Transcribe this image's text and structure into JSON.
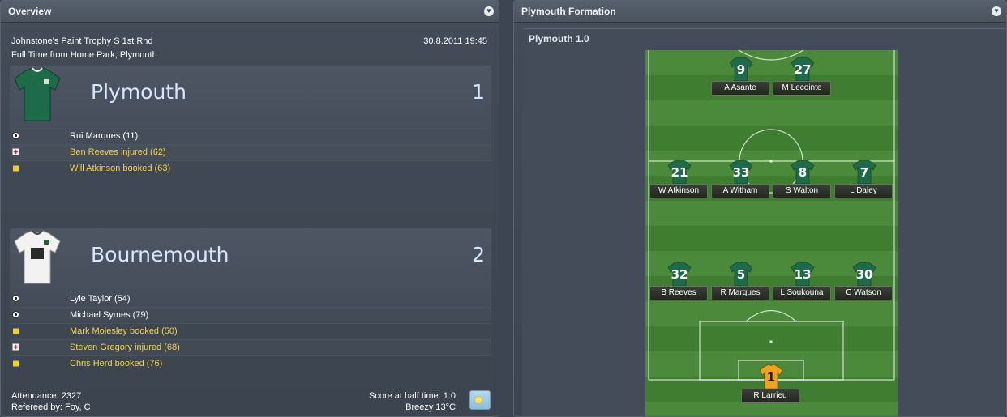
{
  "overview": {
    "title": "Overview",
    "competition": "Johnstone's Paint Trophy S 1st Rnd",
    "datetime": "30.8.2011 19:45",
    "venue": "Full Time from Home Park, Plymouth",
    "home": {
      "name": "Plymouth",
      "score": "1",
      "events": [
        {
          "icon": "ball-icon",
          "text": "Rui Marques (11)",
          "color": "white"
        },
        {
          "icon": "injury-icon",
          "text": "Ben Reeves injured (62)",
          "color": "yellow"
        },
        {
          "icon": "yellow-card-icon",
          "text": "Will Atkinson booked (63)",
          "color": "yellow"
        }
      ]
    },
    "away": {
      "name": "Bournemouth",
      "score": "2",
      "events": [
        {
          "icon": "ball-icon",
          "text": "Lyle Taylor (54)",
          "color": "white"
        },
        {
          "icon": "ball-icon",
          "text": "Michael Symes (79)",
          "color": "white"
        },
        {
          "icon": "yellow-card-icon",
          "text": "Mark Molesley booked (50)",
          "color": "yellow"
        },
        {
          "icon": "injury-icon",
          "text": "Steven Gregory injured (68)",
          "color": "yellow"
        },
        {
          "icon": "yellow-card-icon",
          "text": "Chris Herd booked (76)",
          "color": "yellow"
        }
      ]
    },
    "attendance": "Attendance: 2327",
    "referee": "Refereed by: Foy, C",
    "halftime": "Score at half time: 1:0",
    "weather": "Breezy 13°C"
  },
  "formation": {
    "title": "Plymouth Formation",
    "subtitle": "Plymouth 1.0",
    "players": [
      {
        "number": "9",
        "name": "A Asante",
        "row": 0,
        "col": 1
      },
      {
        "number": "27",
        "name": "M Lecointe",
        "row": 0,
        "col": 2
      },
      {
        "number": "21",
        "name": "W Atkinson",
        "row": 1,
        "col": 0
      },
      {
        "number": "33",
        "name": "A Witham",
        "row": 1,
        "col": 1
      },
      {
        "number": "8",
        "name": "S Walton",
        "row": 1,
        "col": 2
      },
      {
        "number": "7",
        "name": "L Daley",
        "row": 1,
        "col": 3
      },
      {
        "number": "32",
        "name": "B Reeves",
        "row": 2,
        "col": 0
      },
      {
        "number": "5",
        "name": "R Marques",
        "row": 2,
        "col": 1
      },
      {
        "number": "13",
        "name": "L Soukouna",
        "row": 2,
        "col": 2
      },
      {
        "number": "30",
        "name": "C Watson",
        "row": 2,
        "col": 3
      },
      {
        "number": "1",
        "name": "R Larrieu",
        "row": 3,
        "col": 1.5,
        "goalkeeper": true
      }
    ]
  },
  "colors": {
    "home_shirt": "#1e6b4a",
    "away_shirt": "#f2f2f2",
    "gk_shirt": "#f4a01a",
    "event_yellow": "#f6d24a",
    "team_name": "#d6e8ff"
  }
}
